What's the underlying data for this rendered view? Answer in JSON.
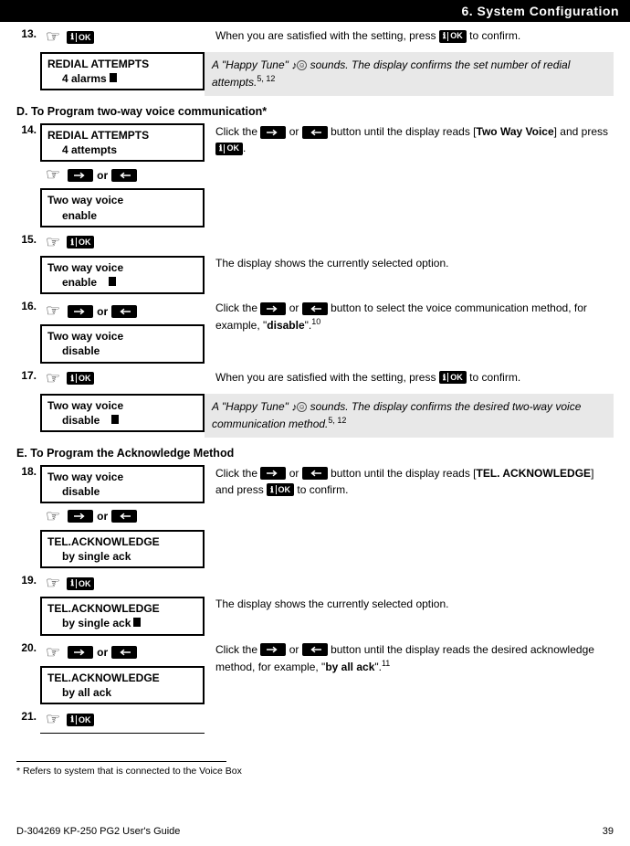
{
  "header": {
    "title": "6. System Configuration"
  },
  "steps": {
    "s13": {
      "num": "13.",
      "display": {
        "l1": "REDIAL ATTEMPTS",
        "l2": "4 alarms"
      },
      "text_a": "When you are satisfied with the setting, press ",
      "text_b": " to confirm.",
      "note_a": "A \"Happy Tune\" ",
      "note_b": " sounds. The display confirms the set number of redial attempts.",
      "sup": "5, 12"
    },
    "sectionD": "D. To Program two-way voice communication*",
    "s14": {
      "num": "14.",
      "d1": {
        "l1": "REDIAL ATTEMPTS",
        "l2": "4 attempts"
      },
      "or": "or",
      "d2": {
        "l1": "Two way voice",
        "l2": "enable"
      },
      "ta": "Click the ",
      "tb": " or ",
      "tc": " button until the display reads [",
      "td": "Two Way Voice",
      "te": "] and press ",
      "tf": "."
    },
    "s15": {
      "num": "15.",
      "d": {
        "l1": "Two way voice",
        "l2": "enable"
      },
      "t": "The display shows the currently selected option."
    },
    "s16": {
      "num": "16.",
      "or": "or",
      "d": {
        "l1": "Two way voice",
        "l2": "disable"
      },
      "ta": "Click the ",
      "tb": " or ",
      "tc": " button to select the voice communication method, for example, \"",
      "td": "disable",
      "te": "\".",
      "sup": "10"
    },
    "s17": {
      "num": "17.",
      "d": {
        "l1": "Two way voice",
        "l2": "disable"
      },
      "ta": "When you are satisfied with the setting, press ",
      "tb": " to confirm.",
      "note_a": "A \"Happy Tune\" ",
      "note_b": " sounds. The display confirms the desired two-way voice communication method.",
      "sup": "5, 12"
    },
    "sectionE": "E. To Program the Acknowledge Method",
    "s18": {
      "num": "18.",
      "d1": {
        "l1": "Two way voice",
        "l2": "disable"
      },
      "or": "or",
      "d2": {
        "l1": "TEL.ACKNOWLEDGE",
        "l2": "by single ack"
      },
      "ta": "Click the ",
      "tb": " or ",
      "tc": " button until the display reads [",
      "td": "TEL. ACKNOWLEDGE",
      "te": "] and press ",
      "tf": " to confirm."
    },
    "s19": {
      "num": "19.",
      "d": {
        "l1": "TEL.ACKNOWLEDGE",
        "l2": "by single ack"
      },
      "t": "The display shows the currently selected option."
    },
    "s20": {
      "num": "20.",
      "or": "or",
      "d": {
        "l1": "TEL.ACKNOWLEDGE",
        "l2": "by all ack"
      },
      "ta": "Click the ",
      "tb": " or ",
      "tc": " button until the display reads the desired acknowledge method, for example, \"",
      "td": "by all ack",
      "te": "\".",
      "sup": "11"
    },
    "s21": {
      "num": "21."
    }
  },
  "footnote": "* Refers to system that is connected to the Voice Box",
  "footer": {
    "guide": "D-304269 KP-250 PG2 User's Guide",
    "page": "39"
  },
  "icons": {
    "ok": "OK"
  }
}
